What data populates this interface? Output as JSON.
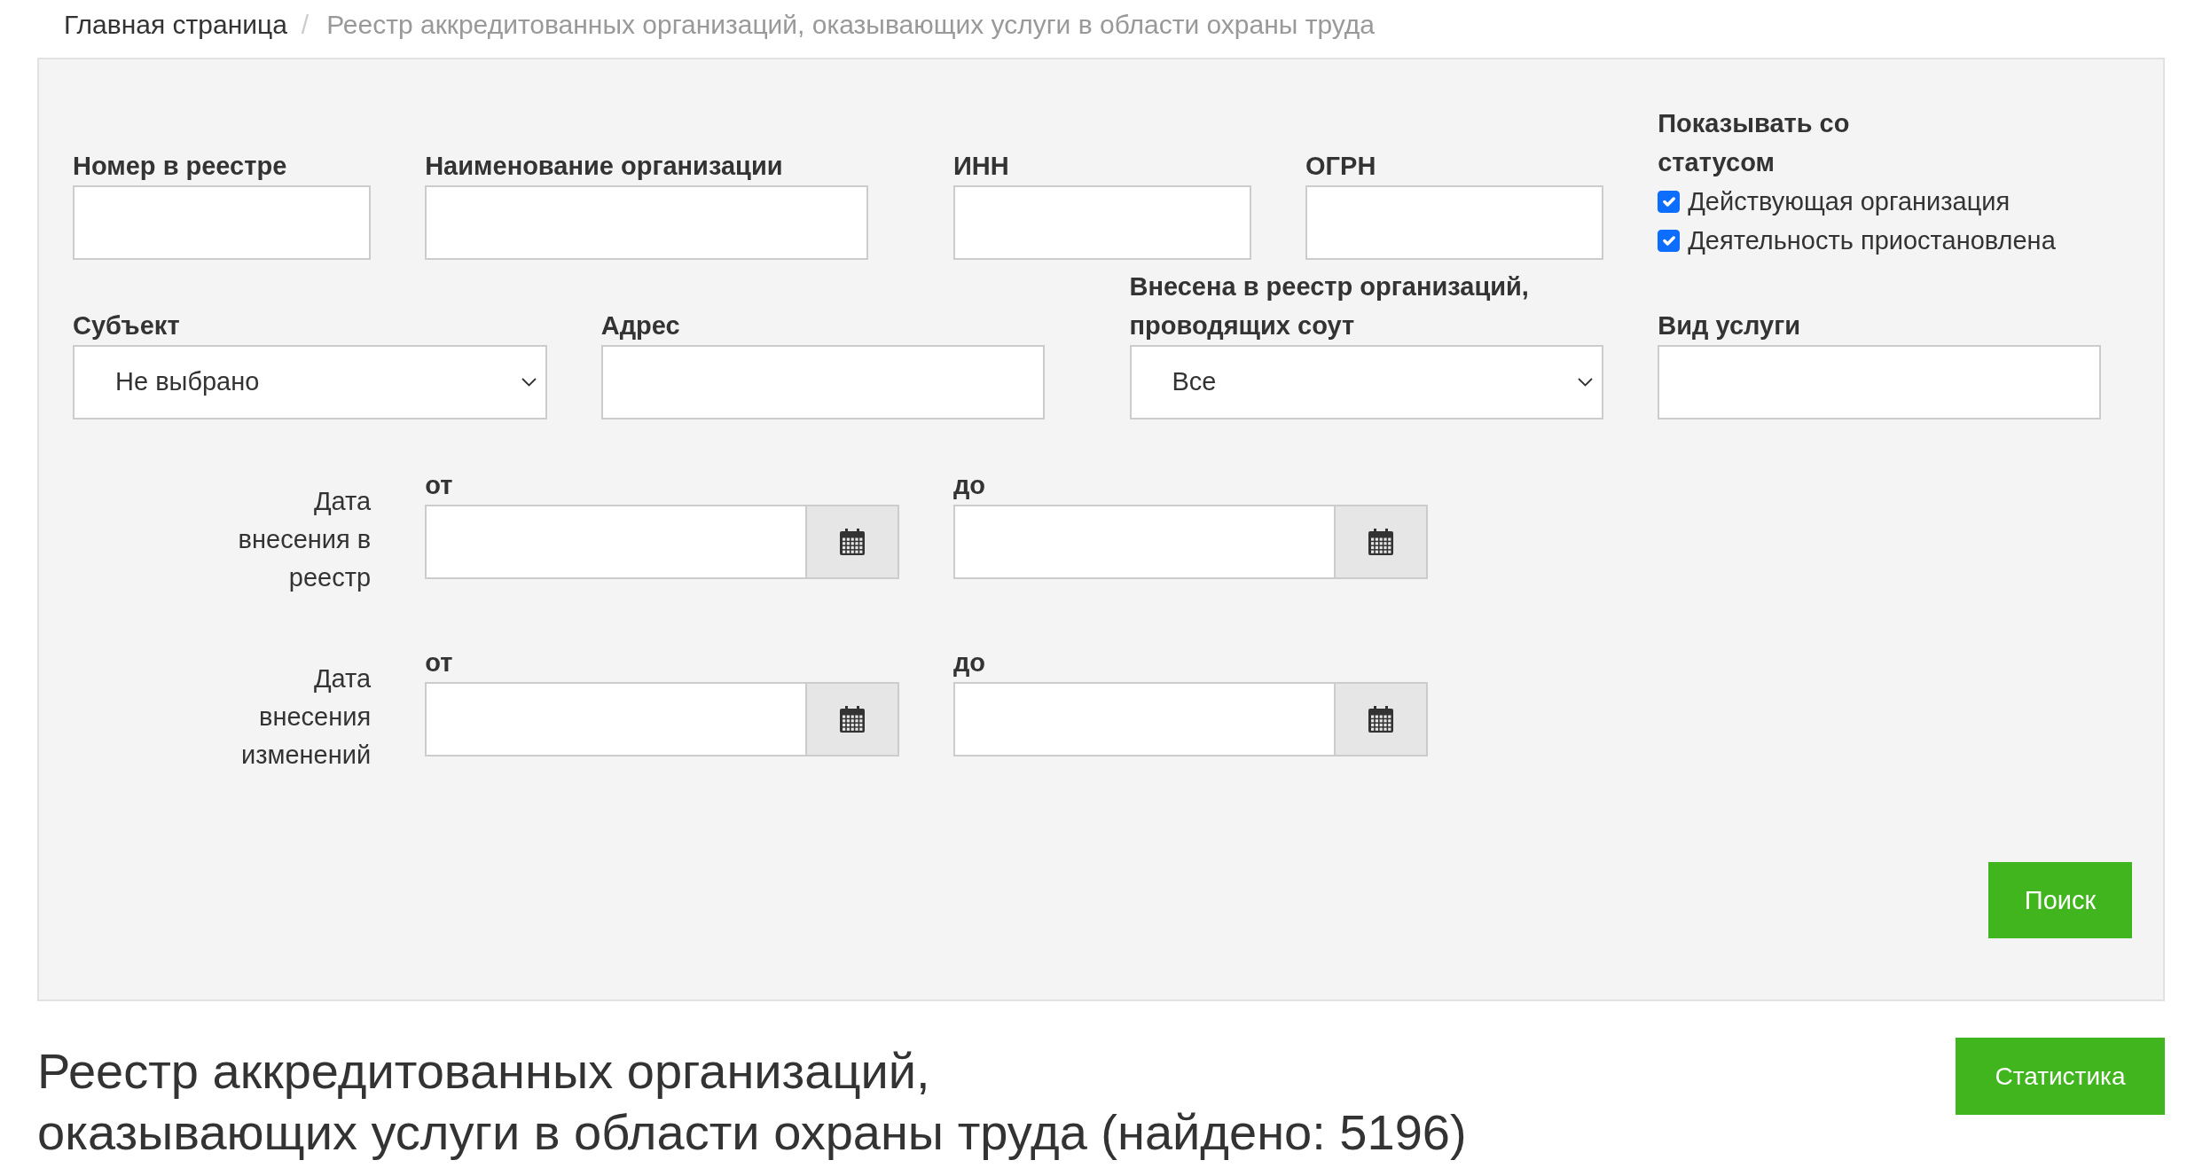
{
  "breadcrumb": {
    "separator": "/",
    "items": [
      {
        "label": "Главная страница",
        "active": false
      },
      {
        "label": "Реестр аккредитованных организаций, оказывающих услуги в области охраны труда",
        "active": true
      }
    ]
  },
  "filter_panel": {
    "rows": [
      {
        "fields": [
          {
            "kind": "text",
            "label": "Номер в реестре"
          },
          {
            "kind": "text",
            "label": "Наименование организации"
          },
          {
            "kind": "text",
            "label": "ИНН"
          },
          {
            "kind": "text",
            "label": "ОГРН"
          },
          {
            "kind": "checkboxes",
            "label": "Показывать со статусом",
            "options": [
              {
                "label": "Действующая организация",
                "checked": true
              },
              {
                "label": "Деятельность приостановлена",
                "checked": true
              }
            ]
          }
        ]
      },
      {
        "fields": [
          {
            "kind": "select",
            "label": "Субъект",
            "value": "Не выбрано"
          },
          {
            "kind": "text",
            "label": "Адрес"
          },
          {
            "kind": "select",
            "label": "Внесена в реестр организаций, проводящих соут",
            "value": "Все"
          },
          {
            "kind": "text",
            "label": "Вид услуги"
          }
        ]
      },
      {
        "fields": [
          {
            "kind": "date_range",
            "label": "Дата внесения в реестр",
            "from_label": "от",
            "to_label": "до"
          }
        ]
      },
      {
        "fields": [
          {
            "kind": "date_range",
            "label": "Дата внесения изменений",
            "from_label": "от",
            "to_label": "до"
          }
        ]
      }
    ],
    "search_button": "Поиск"
  },
  "results_header": {
    "title": "Реестр аккредитованных организаций,\nоказывающих услуги в области охраны труда (найдено: 5196)",
    "statistics_button": "Статистика"
  }
}
